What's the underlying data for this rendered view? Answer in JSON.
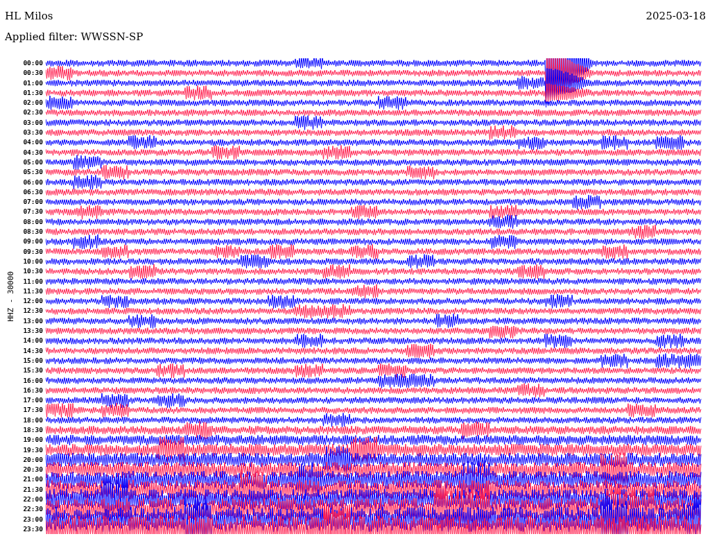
{
  "station": "HL Milos",
  "date": "2025-03-18",
  "filter": "Applied filter: WWSSN-SP",
  "channel_label": "HHZ - 30000",
  "rows": [
    {
      "time": "00:00",
      "color": "#0000ff"
    },
    {
      "time": "00:30",
      "color": "#ff1f4f"
    },
    {
      "time": "01:00",
      "color": "#0000ff"
    },
    {
      "time": "01:30",
      "color": "#ff1f4f"
    },
    {
      "time": "02:00",
      "color": "#0000ff"
    },
    {
      "time": "02:30",
      "color": "#ff1f4f"
    },
    {
      "time": "03:00",
      "color": "#0000ff"
    },
    {
      "time": "03:30",
      "color": "#ff1f4f"
    },
    {
      "time": "04:00",
      "color": "#0000ff"
    },
    {
      "time": "04:30",
      "color": "#ff1f4f"
    },
    {
      "time": "05:00",
      "color": "#0000ff"
    },
    {
      "time": "05:30",
      "color": "#ff1f4f"
    },
    {
      "time": "06:00",
      "color": "#0000ff"
    },
    {
      "time": "06:30",
      "color": "#ff1f4f"
    },
    {
      "time": "07:00",
      "color": "#0000ff"
    },
    {
      "time": "07:30",
      "color": "#ff1f4f"
    },
    {
      "time": "08:00",
      "color": "#0000ff"
    },
    {
      "time": "08:30",
      "color": "#ff1f4f"
    },
    {
      "time": "09:00",
      "color": "#0000ff"
    },
    {
      "time": "09:30",
      "color": "#ff1f4f"
    },
    {
      "time": "10:00",
      "color": "#0000ff"
    },
    {
      "time": "10:30",
      "color": "#ff1f4f"
    },
    {
      "time": "11:00",
      "color": "#0000ff"
    },
    {
      "time": "11:30",
      "color": "#ff1f4f"
    },
    {
      "time": "12:00",
      "color": "#0000ff"
    },
    {
      "time": "12:30",
      "color": "#ff1f4f"
    },
    {
      "time": "13:00",
      "color": "#0000ff"
    },
    {
      "time": "13:30",
      "color": "#ff1f4f"
    },
    {
      "time": "14:00",
      "color": "#0000ff"
    },
    {
      "time": "14:30",
      "color": "#ff1f4f"
    },
    {
      "time": "15:00",
      "color": "#0000ff"
    },
    {
      "time": "15:30",
      "color": "#ff1f4f"
    },
    {
      "time": "16:00",
      "color": "#0000ff"
    },
    {
      "time": "16:30",
      "color": "#ff1f4f"
    },
    {
      "time": "17:00",
      "color": "#0000ff"
    },
    {
      "time": "17:30",
      "color": "#ff1f4f"
    },
    {
      "time": "18:00",
      "color": "#0000ff"
    },
    {
      "time": "18:30",
      "color": "#ff1f4f"
    },
    {
      "time": "19:00",
      "color": "#0000ff"
    },
    {
      "time": "19:30",
      "color": "#ff1f4f"
    },
    {
      "time": "20:00",
      "color": "#0000ff"
    },
    {
      "time": "20:30",
      "color": "#ff1f4f"
    },
    {
      "time": "21:00",
      "color": "#0000ff"
    },
    {
      "time": "21:30",
      "color": "#ff1f4f"
    },
    {
      "time": "22:00",
      "color": "#0000ff"
    },
    {
      "time": "22:30",
      "color": "#ff1f4f"
    },
    {
      "time": "23:00",
      "color": "#0000ff"
    },
    {
      "time": "23:30",
      "color": "#ff1f4f"
    }
  ]
}
